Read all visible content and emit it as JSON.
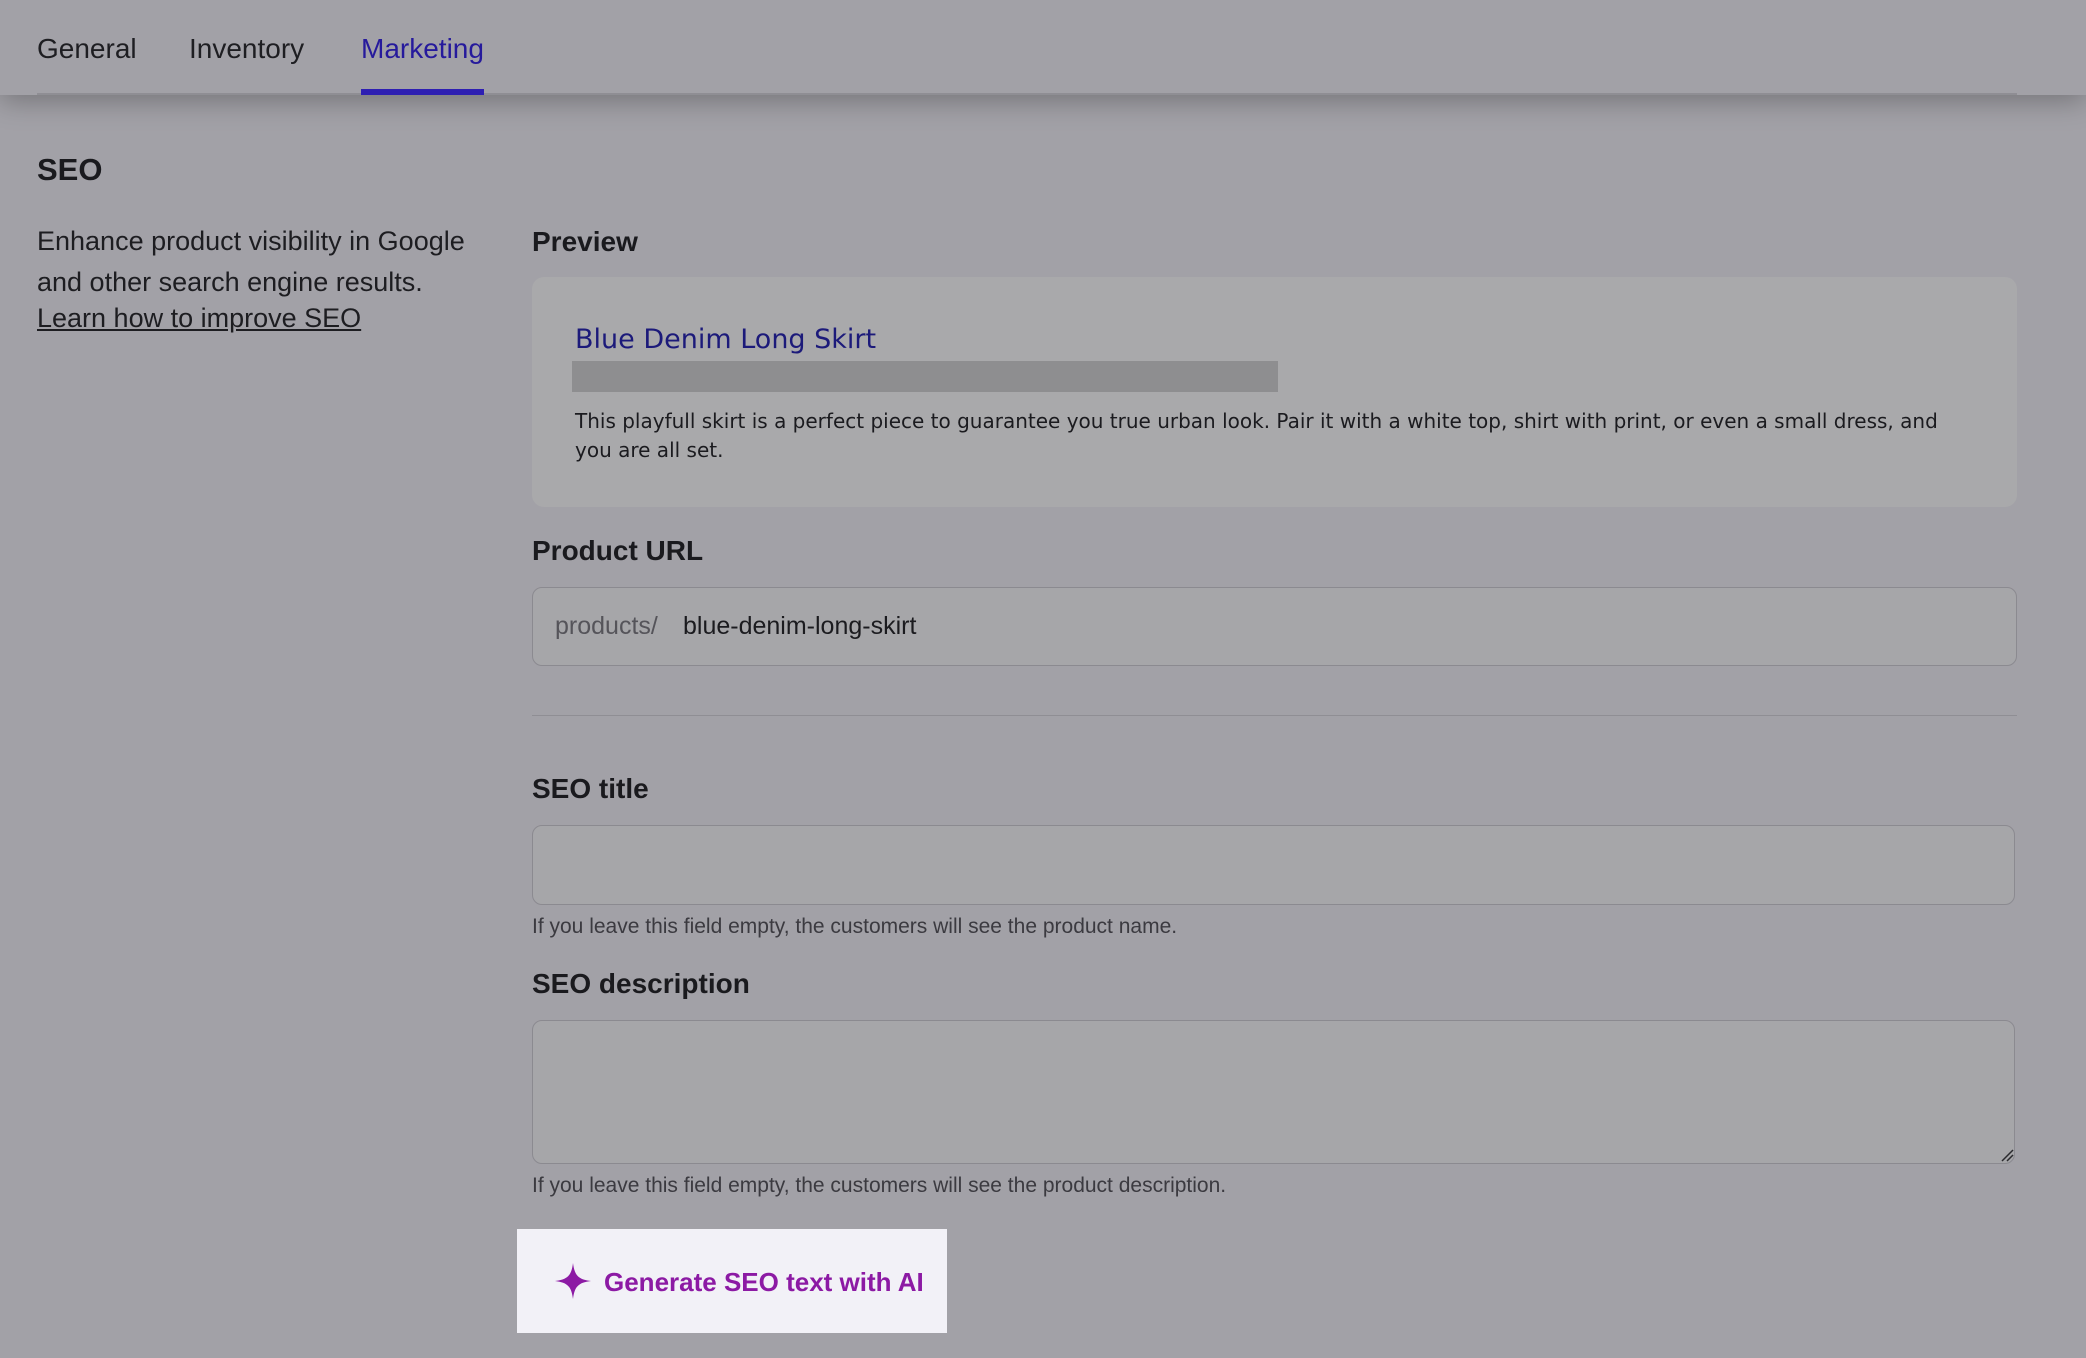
{
  "tabs": [
    {
      "label": "General"
    },
    {
      "label": "Inventory"
    },
    {
      "label": "Marketing"
    }
  ],
  "active_tab": "Marketing",
  "seo_section": {
    "title": "SEO",
    "description": "Enhance product visibility in Google and other search engine results.",
    "link_label": "Learn how to improve SEO"
  },
  "preview": {
    "label": "Preview",
    "title": "Blue Denim Long Skirt",
    "description": "This playfull skirt is a perfect piece to guarantee you true urban look. Pair it with a white top, shirt with print, or even a small dress, and you are all set."
  },
  "product_url": {
    "label": "Product URL",
    "prefix": "products/",
    "value": "blue-denim-long-skirt"
  },
  "seo_title": {
    "label": "SEO title",
    "value": "",
    "help": "If you leave this field empty, the customers will see the product name."
  },
  "seo_description": {
    "label": "SEO description",
    "value": "",
    "help": "If you leave this field empty, the customers will see the product description."
  },
  "ai_button": {
    "label": "Generate SEO text with AI",
    "icon": "sparkle-icon"
  },
  "colors": {
    "accent": "#2e1fb2",
    "ai_accent": "#8c1aa4",
    "preview_link": "#1c1a7a"
  }
}
